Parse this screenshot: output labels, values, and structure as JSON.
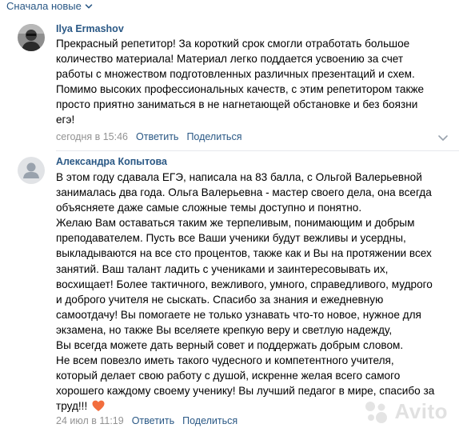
{
  "sort": {
    "label": "Сначала новые"
  },
  "comments": [
    {
      "author": "Ilya Ermashov",
      "lines": [
        "Прекрасный репетитор! За короткий срок смогли отработать большое",
        "количество материала! Материал легко поддается усвоению за счет",
        "работы с множеством подготовленных различных презентаций и схем.",
        "Помимо высоких профессиональных качеств, с этим репетитором также",
        "просто приятно заниматься в не нагнетающей обстановке и без боязни",
        "егэ!"
      ],
      "date": "сегодня в 15:46",
      "reply": "Ответить",
      "share": "Поделиться"
    },
    {
      "author": "Александра Копытова",
      "lines": [
        "В этом году сдавала ЕГЭ, написала на 83 балла, с Ольгой Валерьевной",
        "занималась два года. Ольга Валерьевна - мастер своего дела, она всегда",
        "объясняете даже самые сложные темы доступно и понятно.",
        "Желаю Вам оставаться таким же терпеливым, понимающим и добрым",
        "преподавателем. Пусть все Ваши ученики будут вежливы и усердны,",
        "выкладываются на все сто процентов, также как и Вы на протяжении всех",
        "занятий. Ваш талант ладить с учениками и заинтересовывать их,",
        "восхищает! Более тактичного, вежливого, умного, справедливого, мудрого",
        "и доброго учителя не сыскать. Спасибо за знания и ежедневную",
        "самоотдачу! Вы помогаете не только узнавать что-то новое, нужное для",
        "экзамена, но также Вы вселяете крепкую веру и светлую надежду,",
        "Вы всегда можете дать верный совет и поддержать добрым словом.",
        "Не всем повезло иметь такого чудесного и компетентного учителя,",
        "который делает свою работу с душой, искренне желая всего самого",
        "хорошего каждому своему ученику! Вы лучший педагог в мире, спасибо за",
        "труд!!! "
      ],
      "date": "24 июл в 11:19",
      "reply": "Ответить",
      "share": "Поделиться"
    }
  ],
  "watermark": "Avito",
  "colors": {
    "link": "#2a5885",
    "meta": "#939393",
    "divider": "#e7e8ec",
    "heart": "#f26d3d"
  },
  "icons": [
    "chevron-down-icon",
    "more-options-icon",
    "heart-emoji-icon",
    "avito-logo-icon"
  ]
}
